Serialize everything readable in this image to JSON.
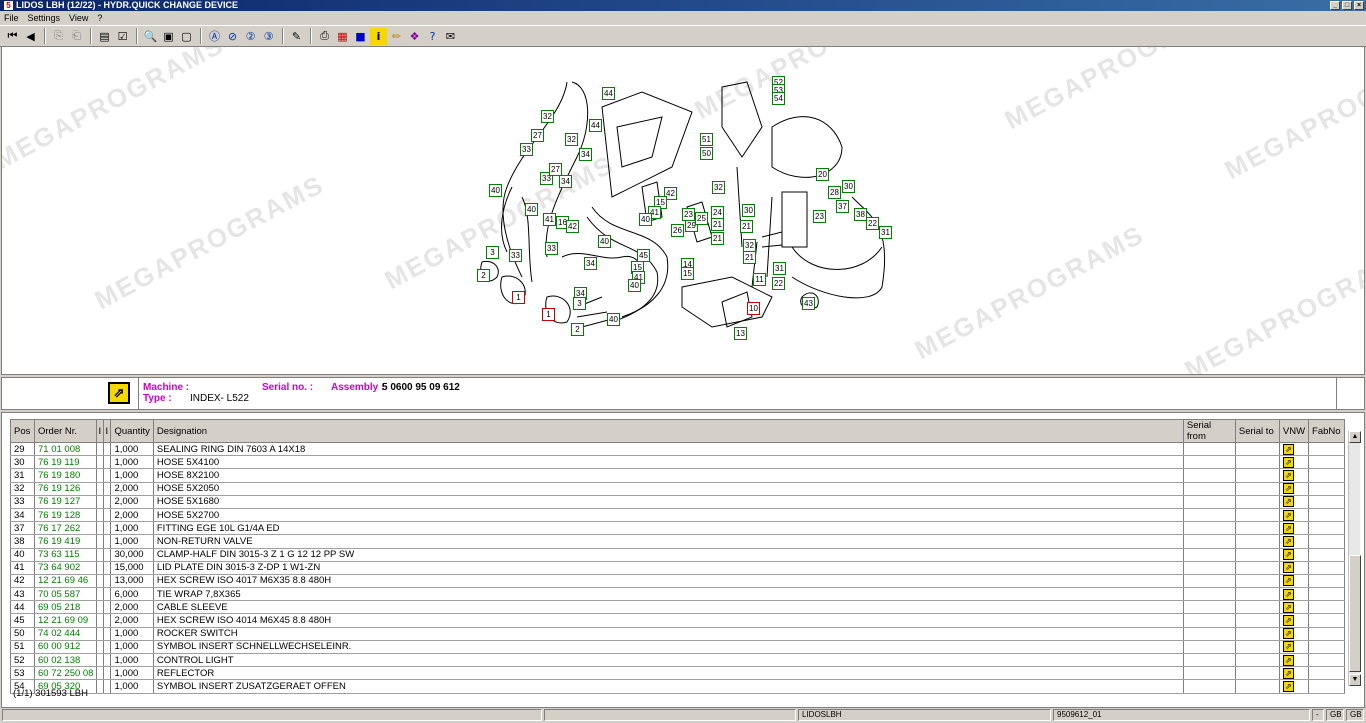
{
  "window": {
    "title": "LIDOS LBH (12/22) - HYDR.QUICK CHANGE DEVICE",
    "app_badge": "5"
  },
  "menu": [
    "File",
    "Settings",
    "View",
    "?"
  ],
  "toolbar_icons": [
    "first-page-icon",
    "previous-icon",
    "back-icon",
    "forward-icon",
    "print-list-icon",
    "checklist-icon",
    "zoom-icon",
    "page-icon",
    "page-alt-icon",
    "search-a-icon",
    "search-b-icon",
    "search-2-icon",
    "search-3-icon",
    "edit-icon",
    "printer-icon",
    "grid-icon",
    "blue-square-icon",
    "info-icon",
    "pencil-icon",
    "book-icon",
    "help-icon",
    "mail-icon"
  ],
  "drawing": {
    "callouts": [
      "44",
      "32",
      "27",
      "33",
      "32",
      "34",
      "44",
      "33",
      "27",
      "34",
      "40",
      "40",
      "41",
      "16",
      "42",
      "33",
      "40",
      "3",
      "33",
      "2",
      "1",
      "34",
      "45",
      "15",
      "41",
      "40",
      "34",
      "3",
      "2",
      "40",
      "1",
      "52",
      "53",
      "54",
      "51",
      "50",
      "32",
      "20",
      "30",
      "28",
      "37",
      "38",
      "23",
      "22",
      "31",
      "42",
      "15",
      "41",
      "40",
      "29",
      "25",
      "24",
      "26",
      "23",
      "21",
      "30",
      "21",
      "21",
      "32",
      "21",
      "14",
      "15",
      "11",
      "31",
      "22",
      "10",
      "13",
      "43"
    ],
    "callouts_red": [
      "1",
      "1",
      "10"
    ],
    "watermark": "MEGAPROGRAMS"
  },
  "info": {
    "machine_label": "Machine :",
    "machine_value": "",
    "serial_label": "Serial no. :",
    "serial_value": "",
    "assembly_label": "Assembly :",
    "assembly_value": "5 0600 95 09 612",
    "type_label": "Type :",
    "type_value": "INDEX- L522"
  },
  "table": {
    "headers": [
      "Pos",
      "Order Nr.",
      "I",
      "I",
      "Quantity",
      "Designation",
      "Serial from",
      "Serial to",
      "VNW",
      "FabNo"
    ],
    "rows": [
      {
        "pos": "29",
        "order": "71 01 008",
        "qty": "1,000",
        "desc": "SEALING RING DIN 7603 A 14X18"
      },
      {
        "pos": "30",
        "order": "76 19 119",
        "qty": "1,000",
        "desc": "HOSE 5X4100"
      },
      {
        "pos": "31",
        "order": "76 19 180",
        "qty": "1,000",
        "desc": "HOSE 8X2100"
      },
      {
        "pos": "32",
        "order": "76 19 126",
        "qty": "2,000",
        "desc": "HOSE 5X2050"
      },
      {
        "pos": "33",
        "order": "76 19 127",
        "qty": "2,000",
        "desc": "HOSE 5X1680"
      },
      {
        "pos": "34",
        "order": "76 19 128",
        "qty": "2,000",
        "desc": "HOSE 5X2700"
      },
      {
        "pos": "37",
        "order": "76 17 262",
        "qty": "1,000",
        "desc": "FITTING EGE 10L G1/4A ED"
      },
      {
        "pos": "38",
        "order": "76 19 419",
        "qty": "1,000",
        "desc": "NON-RETURN VALVE"
      },
      {
        "pos": "40",
        "order": "73 63 115",
        "qty": "30,000",
        "desc": "CLAMP-HALF DIN 3015-3 Z 1 G 12 12 PP SW"
      },
      {
        "pos": "41",
        "order": "73 64 902",
        "qty": "15,000",
        "desc": "LID PLATE DIN 3015-3 Z-DP 1 W1-ZN"
      },
      {
        "pos": "42",
        "order": "12 21 69 46",
        "qty": "13,000",
        "desc": "HEX SCREW ISO 4017 M6X35 8.8 480H"
      },
      {
        "pos": "43",
        "order": "70 05 587",
        "qty": "6,000",
        "desc": "TIE WRAP 7,8X365"
      },
      {
        "pos": "44",
        "order": "69 05 218",
        "qty": "2,000",
        "desc": "CABLE SLEEVE"
      },
      {
        "pos": "45",
        "order": "12 21 69 09",
        "qty": "2,000",
        "desc": "HEX SCREW ISO 4014 M6X45 8.8 480H"
      },
      {
        "pos": "50",
        "order": "74 02 444",
        "qty": "1,000",
        "desc": "ROCKER SWITCH"
      },
      {
        "pos": "51",
        "order": "60 00 912",
        "qty": "1,000",
        "desc": "SYMBOL INSERT SCHNELLWECHSELEINR."
      },
      {
        "pos": "52",
        "order": "60 02 138",
        "qty": "1,000",
        "desc": "CONTROL LIGHT"
      },
      {
        "pos": "53",
        "order": "60 72 250 08",
        "qty": "1,000",
        "desc": "REFLECTOR"
      },
      {
        "pos": "54",
        "order": "69 05 320",
        "qty": "1,000",
        "desc": "SYMBOL INSERT ZUSATZGERAET OFFEN"
      }
    ],
    "footer": "(1/1) 301593 LBH"
  },
  "status": {
    "app": "LIDOSLBH",
    "doc": "9509612_01",
    "lang1": "GB",
    "lang2": "GB",
    "dash": "-"
  },
  "colors": {
    "order_nr": "#008000",
    "callout_border": "#008000",
    "callout_red": "#cc0000",
    "label_magenta": "#cc00cc",
    "vnw_yellow": "#f5d800"
  }
}
